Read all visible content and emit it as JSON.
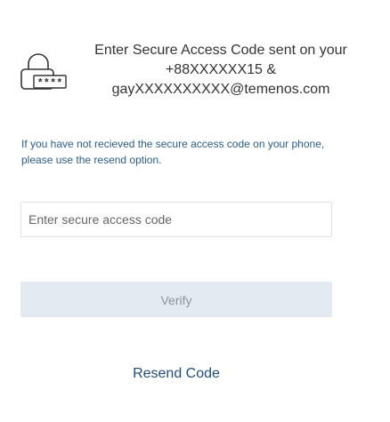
{
  "header": {
    "icon": "lock-code-icon",
    "lines": [
      "Enter Secure Access Code sent on your",
      "+88XXXXXX15 &",
      "gayXXXXXXXXXX@temenos.com"
    ],
    "lock_code_text": "****"
  },
  "info": {
    "lines": [
      "If you have not recieved the secure access code on your phone,",
      "please use the resend option."
    ]
  },
  "form": {
    "code_placeholder": "Enter secure access code",
    "code_value": ""
  },
  "actions": {
    "verify_label": "Verify",
    "resend_label": "Resend Code"
  },
  "colors": {
    "info_text": "#2b5d8a",
    "link": "#1f4e79",
    "button_disabled_bg": "#e4eaf1",
    "button_disabled_text": "#8a94a0",
    "input_border": "#dde1e6"
  }
}
